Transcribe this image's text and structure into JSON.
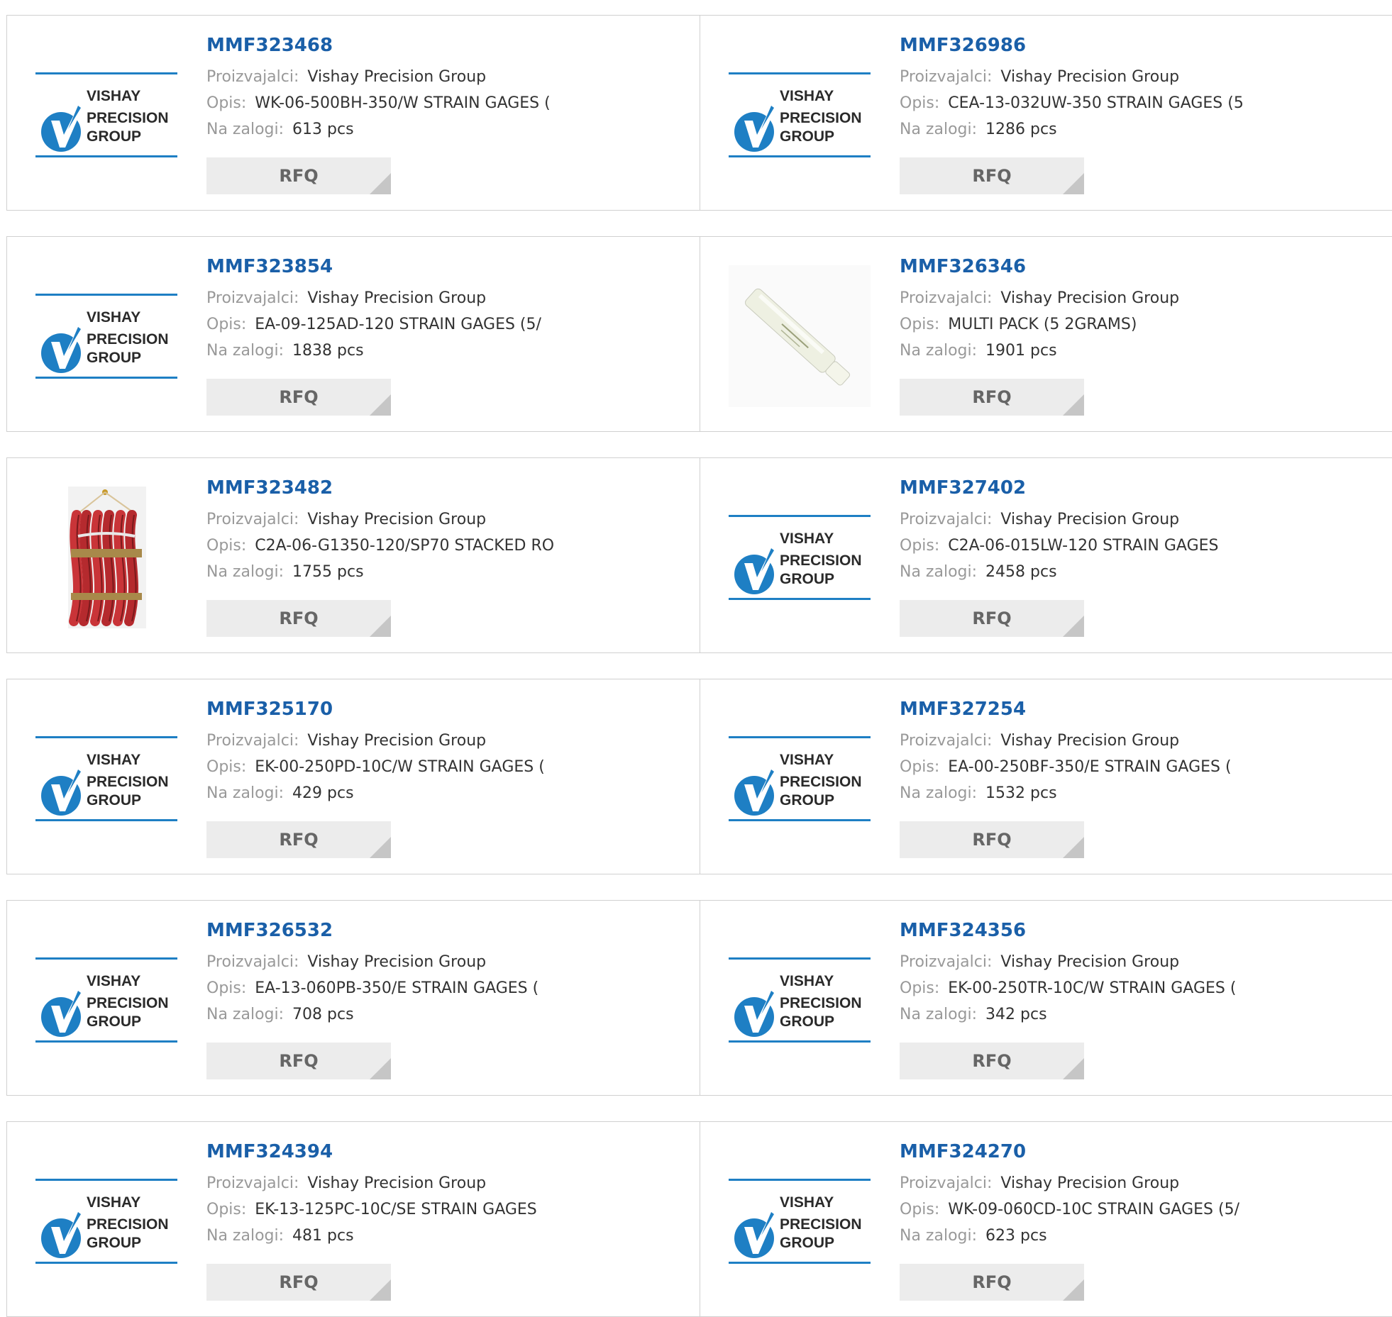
{
  "labels": {
    "manufacturer": "Proizvajalci:",
    "description": "Opis:",
    "stock": "Na zalogi:",
    "rfq": "RFQ"
  },
  "logo": {
    "line1": "VISHAY",
    "line2": "PRECISION",
    "line3": "GROUP",
    "blue": "#1e7fc4"
  },
  "products": [
    {
      "pn": "MMF323468",
      "mfr": "Vishay Precision Group",
      "desc": "WK-06-500BH-350/W STRAIN GAGES (",
      "stock": "613 pcs",
      "img": "vishay-logo"
    },
    {
      "pn": "MMF326986",
      "mfr": "Vishay Precision Group",
      "desc": "CEA-13-032UW-350 STRAIN GAGES (5",
      "stock": "1286 pcs",
      "img": "vishay-logo"
    },
    {
      "pn": "MMF323854",
      "mfr": "Vishay Precision Group",
      "desc": "EA-09-125AD-120 STRAIN GAGES (5/",
      "stock": "1838 pcs",
      "img": "vishay-logo"
    },
    {
      "pn": "MMF326346",
      "mfr": "Vishay Precision Group",
      "desc": "MULTI PACK (5 2GRAMS)",
      "stock": "1901 pcs",
      "img": "adhesive-bottle"
    },
    {
      "pn": "MMF323482",
      "mfr": "Vishay Precision Group",
      "desc": "C2A-06-G1350-120/SP70 STACKED RO",
      "stock": "1755 pcs",
      "img": "wire-bundle"
    },
    {
      "pn": "MMF327402",
      "mfr": "Vishay Precision Group",
      "desc": "C2A-06-015LW-120 STRAIN GAGES",
      "stock": "2458 pcs",
      "img": "vishay-logo"
    },
    {
      "pn": "MMF325170",
      "mfr": "Vishay Precision Group",
      "desc": "EK-00-250PD-10C/W STRAIN GAGES (",
      "stock": "429 pcs",
      "img": "vishay-logo"
    },
    {
      "pn": "MMF327254",
      "mfr": "Vishay Precision Group",
      "desc": "EA-00-250BF-350/E STRAIN GAGES (",
      "stock": "1532 pcs",
      "img": "vishay-logo"
    },
    {
      "pn": "MMF326532",
      "mfr": "Vishay Precision Group",
      "desc": "EA-13-060PB-350/E STRAIN GAGES (",
      "stock": "708 pcs",
      "img": "vishay-logo"
    },
    {
      "pn": "MMF324356",
      "mfr": "Vishay Precision Group",
      "desc": "EK-00-250TR-10C/W STRAIN GAGES (",
      "stock": "342 pcs",
      "img": "vishay-logo"
    },
    {
      "pn": "MMF324394",
      "mfr": "Vishay Precision Group",
      "desc": "EK-13-125PC-10C/SE STRAIN GAGES",
      "stock": "481 pcs",
      "img": "vishay-logo"
    },
    {
      "pn": "MMF324270",
      "mfr": "Vishay Precision Group",
      "desc": "WK-09-060CD-10C STRAIN GAGES (5/",
      "stock": "623 pcs",
      "img": "vishay-logo"
    }
  ]
}
